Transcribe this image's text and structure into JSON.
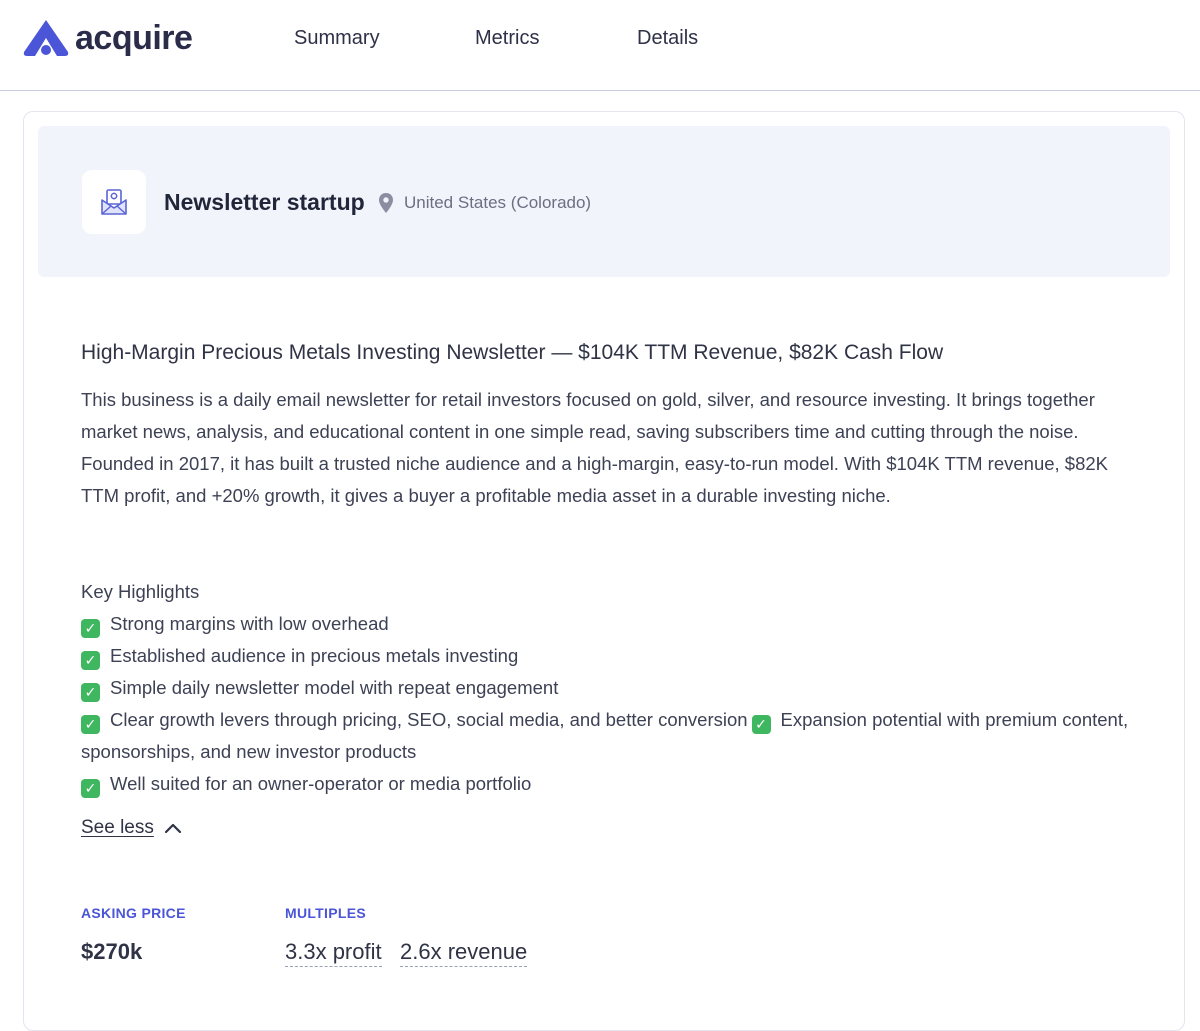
{
  "brand": {
    "name": "acquire",
    "color": "#4a55d8"
  },
  "nav": {
    "items": [
      {
        "label": "Summary"
      },
      {
        "label": "Metrics"
      },
      {
        "label": "Details"
      }
    ]
  },
  "listing": {
    "category": "Newsletter startup",
    "category_icon": "newsletter-envelope-icon",
    "location": "United States (Colorado)",
    "title": "High-Margin Precious Metals Investing Newsletter — $104K TTM Revenue, $82K Cash Flow",
    "description": "This business is a daily email newsletter for retail investors focused on gold, silver, and resource investing. It brings together market news, analysis, and educational content in one simple read, saving subscribers time and cutting through the noise. Founded in 2017, it has built a trusted niche audience and a high-margin, easy-to-run model. With $104K TTM revenue, $82K TTM profit, and +20% growth, it gives a buyer a profitable media asset in a durable investing niche.",
    "highlights_heading": "Key Highlights",
    "highlights": [
      "Strong margins with low overhead",
      "Established audience in precious metals investing",
      "Simple daily newsletter model with repeat engagement",
      "Clear growth levers through pricing, SEO, social media, and better conversion",
      "Expansion potential with premium content, sponsorships, and new investor products",
      "Well suited for an owner-operator or media portfolio"
    ],
    "see_less_label": "See less",
    "check_color": "#3fb660"
  },
  "stats": {
    "asking_price_label": "ASKING PRICE",
    "asking_price": "$270k",
    "multiples_label": "MULTIPLES",
    "profit_multiple": "3.3x profit",
    "revenue_multiple": "2.6x revenue"
  }
}
